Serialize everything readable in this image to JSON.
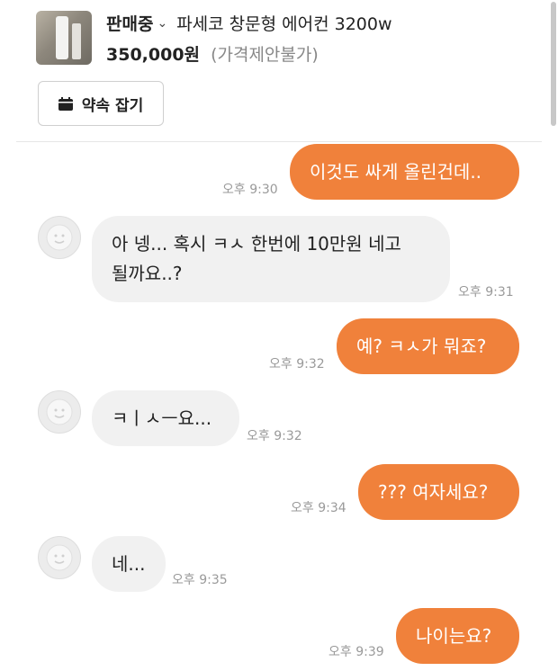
{
  "product": {
    "status": "판매중",
    "status_chevron": "⌄",
    "title": "파세코 창문형 에어컨 3200w",
    "price": "350,000원",
    "negotiation": "(가격제안불가)",
    "thumbnail_icon": "product-thumbnail"
  },
  "appointment_button": {
    "icon": "calendar-icon",
    "label": "약속 잡기"
  },
  "colors": {
    "my_bubble": "#f0813b",
    "their_bubble": "#f1f1f1",
    "timestamp": "#9a9a9a"
  },
  "messages": [
    {
      "sender": "me",
      "text": "이것도 싸게 올린건데..",
      "time": "오후 9:30"
    },
    {
      "sender": "them",
      "text_line1": "아 넹... 혹시 ㅋㅅ 한번에 10만원 네고",
      "text_line2": "될까요..?",
      "time": "오후 9:31"
    },
    {
      "sender": "me",
      "text": "예? ㅋㅅ가 뭐죠?",
      "time": "오후 9:32"
    },
    {
      "sender": "them",
      "text": "ㅋㅣㅅㅡ요...",
      "time": "오후 9:32"
    },
    {
      "sender": "me",
      "text": "??? 여자세요?",
      "time": "오후 9:34"
    },
    {
      "sender": "them",
      "text": "네...",
      "time": "오후 9:35"
    },
    {
      "sender": "me",
      "text": "나이는요?",
      "time": "오후 9:39"
    }
  ]
}
